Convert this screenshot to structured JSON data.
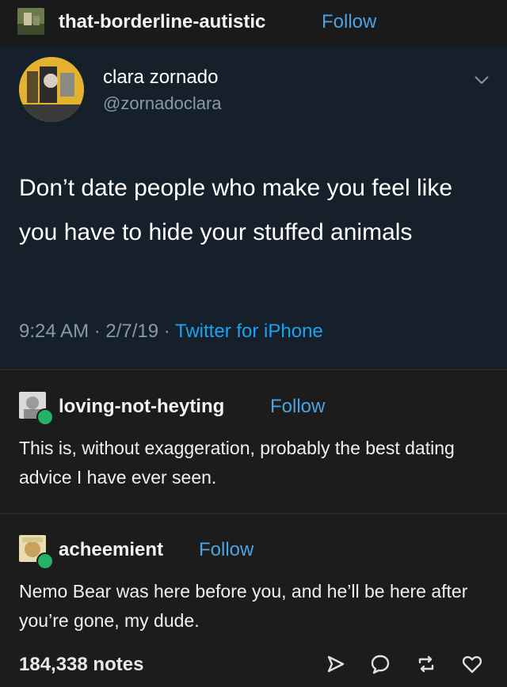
{
  "header": {
    "username": "that-borderline-autistic",
    "follow_label": "Follow",
    "avatar_icon": "blog-avatar-icon"
  },
  "tweet": {
    "display_name": "clara zornado",
    "handle": "@zornadoclara",
    "text": "Don’t date people who make you feel like you have to hide your stuffed animals",
    "timestamp": "9:24 AM · 2/7/19 · ",
    "source": "Twitter for iPhone",
    "menu_icon": "chevron-down-icon"
  },
  "reblogs": [
    {
      "username": "loving-not-heyting",
      "follow_label": "Follow",
      "text": "This is, without exaggeration, probably the best dating advice I have ever seen."
    },
    {
      "username": "acheemient",
      "follow_label": "Follow",
      "text": "Nemo Bear was here before you, and he’ll be here after you’re gone, my dude."
    }
  ],
  "footer": {
    "notes": "184,338 notes",
    "actions": [
      "share-icon",
      "reply-icon",
      "reblog-icon",
      "like-icon"
    ]
  },
  "colors": {
    "follow": "#4ba3e3",
    "tweet_bg": "#15202b",
    "twitter_blue": "#1da1f2",
    "reblog_green": "#24b364"
  }
}
